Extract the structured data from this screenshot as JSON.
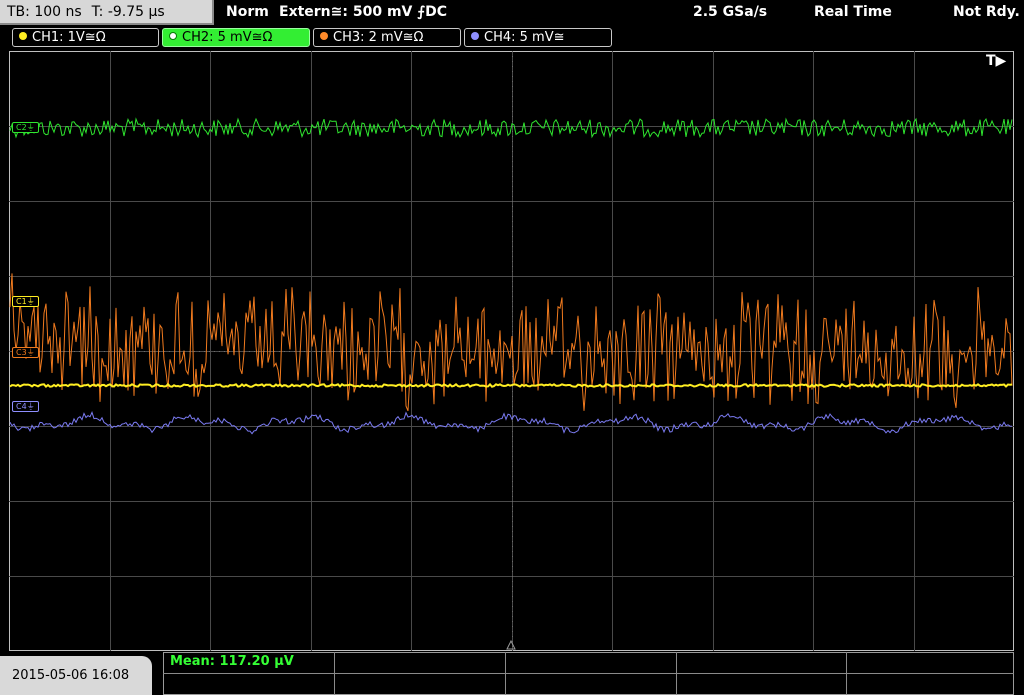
{
  "top_bar": {
    "timebase": "TB: 100 ns",
    "trigger_time": "T: -9.75 µs",
    "mode": "Norm",
    "trigger_source": "Extern≅: 500 mV ⨍DC",
    "sample_rate": "2.5 GSa/s",
    "acq_mode": "Real Time",
    "status": "Not Rdy."
  },
  "channels": [
    {
      "label": "CH1: 1V≅Ω",
      "color": "#ffee22",
      "active": false
    },
    {
      "label": "CH2: 5 mV≅Ω",
      "color": "#33ee33",
      "active": true
    },
    {
      "label": "CH3: 2 mV≅Ω",
      "color": "#ff8a2a",
      "active": false
    },
    {
      "label": "CH4: 5 mV≅",
      "color": "#8f8fff",
      "active": false
    }
  ],
  "markers": {
    "ch1": "C1",
    "ch2": "C2",
    "ch3": "C3",
    "ch4": "C4"
  },
  "trigger_indicator": "T▶",
  "footer": {
    "datetime": "2015-05-06 16:08",
    "measurement": "Mean: 117.20 µV"
  },
  "colors": {
    "ch1": "#ffee22",
    "ch2": "#2fe62f",
    "ch3": "#f07a1e",
    "ch4": "#7b7bf2",
    "grid": "#4a4a4a"
  }
}
